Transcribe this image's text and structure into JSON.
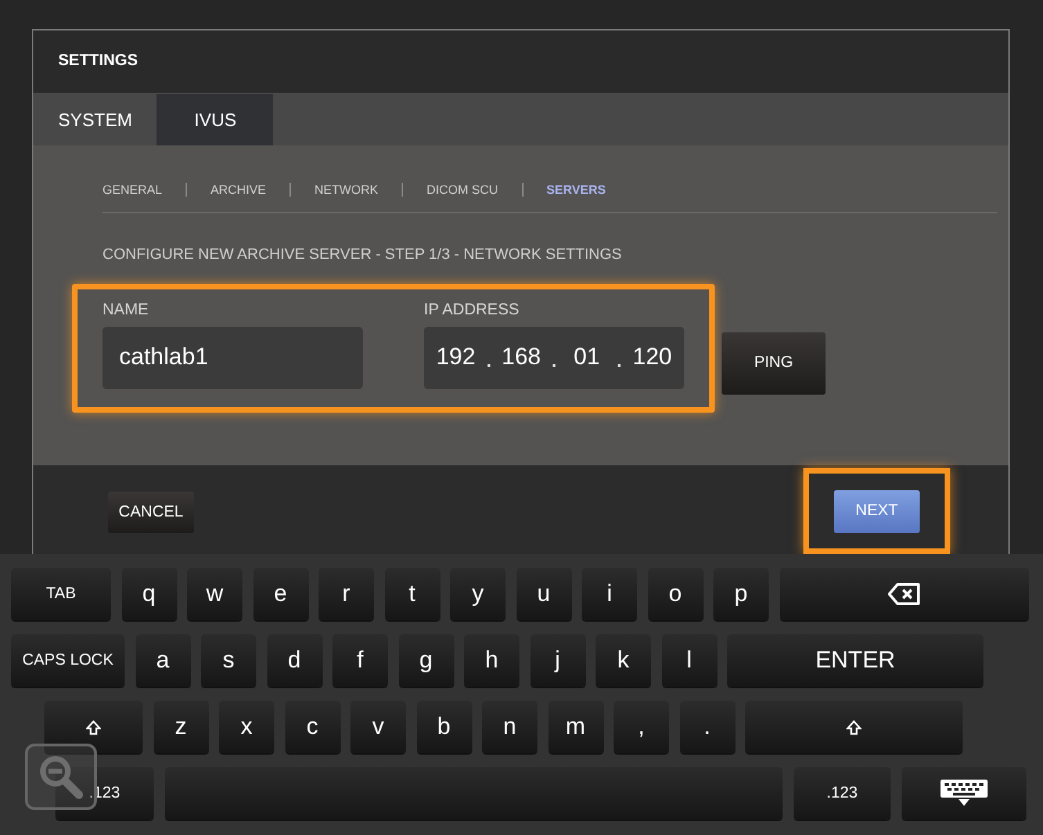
{
  "dialog": {
    "title": "SETTINGS",
    "tabs": [
      {
        "label": "SYSTEM",
        "selected": false
      },
      {
        "label": "IVUS",
        "selected": true
      }
    ],
    "subtabs": [
      {
        "label": "GENERAL",
        "selected": false
      },
      {
        "label": "ARCHIVE",
        "selected": false
      },
      {
        "label": "NETWORK",
        "selected": false
      },
      {
        "label": "DICOM SCU",
        "selected": false
      },
      {
        "label": "SERVERS",
        "selected": true
      }
    ],
    "step_text": "CONFIGURE NEW ARCHIVE SERVER - STEP 1/3 - NETWORK SETTINGS",
    "fields_highlighted": true,
    "name": {
      "label": "NAME",
      "value": "cathlab1"
    },
    "ip_address": {
      "label": "IP ADDRESS",
      "octets": [
        "192",
        "168",
        "01",
        "120"
      ]
    },
    "ping_button": "PING",
    "cancel_button": "CANCEL",
    "next_button": {
      "label": "NEXT",
      "highlighted": true
    }
  },
  "keyboard": {
    "rows": [
      [
        {
          "kind": "tab",
          "label": "TAB"
        },
        {
          "kind": "letter",
          "label": "q"
        },
        {
          "kind": "letter",
          "label": "w"
        },
        {
          "kind": "letter",
          "label": "e"
        },
        {
          "kind": "letter",
          "label": "r"
        },
        {
          "kind": "letter",
          "label": "t"
        },
        {
          "kind": "letter",
          "label": "y"
        },
        {
          "kind": "letter",
          "label": "u"
        },
        {
          "kind": "letter",
          "label": "i"
        },
        {
          "kind": "letter",
          "label": "o"
        },
        {
          "kind": "letter",
          "label": "p"
        },
        {
          "kind": "backspace"
        }
      ],
      [
        {
          "kind": "caps",
          "label": "CAPS LOCK"
        },
        {
          "kind": "letter",
          "label": "a"
        },
        {
          "kind": "letter",
          "label": "s"
        },
        {
          "kind": "letter",
          "label": "d"
        },
        {
          "kind": "letter",
          "label": "f"
        },
        {
          "kind": "letter",
          "label": "g"
        },
        {
          "kind": "letter",
          "label": "h"
        },
        {
          "kind": "letter",
          "label": "j"
        },
        {
          "kind": "letter",
          "label": "k"
        },
        {
          "kind": "letter",
          "label": "l"
        },
        {
          "kind": "enter",
          "label": "ENTER"
        }
      ],
      [
        {
          "kind": "shift"
        },
        {
          "kind": "letter",
          "label": "z"
        },
        {
          "kind": "letter",
          "label": "x"
        },
        {
          "kind": "letter",
          "label": "c"
        },
        {
          "kind": "letter",
          "label": "v"
        },
        {
          "kind": "letter",
          "label": "b"
        },
        {
          "kind": "letter",
          "label": "n"
        },
        {
          "kind": "letter",
          "label": "m"
        },
        {
          "kind": "letter",
          "label": ","
        },
        {
          "kind": "letter",
          "label": "."
        },
        {
          "kind": "shift_right"
        }
      ],
      [
        {
          "kind": "num",
          "label": ".123"
        },
        {
          "kind": "space"
        },
        {
          "kind": "num_right",
          "label": ".123"
        },
        {
          "kind": "hide"
        }
      ]
    ]
  }
}
